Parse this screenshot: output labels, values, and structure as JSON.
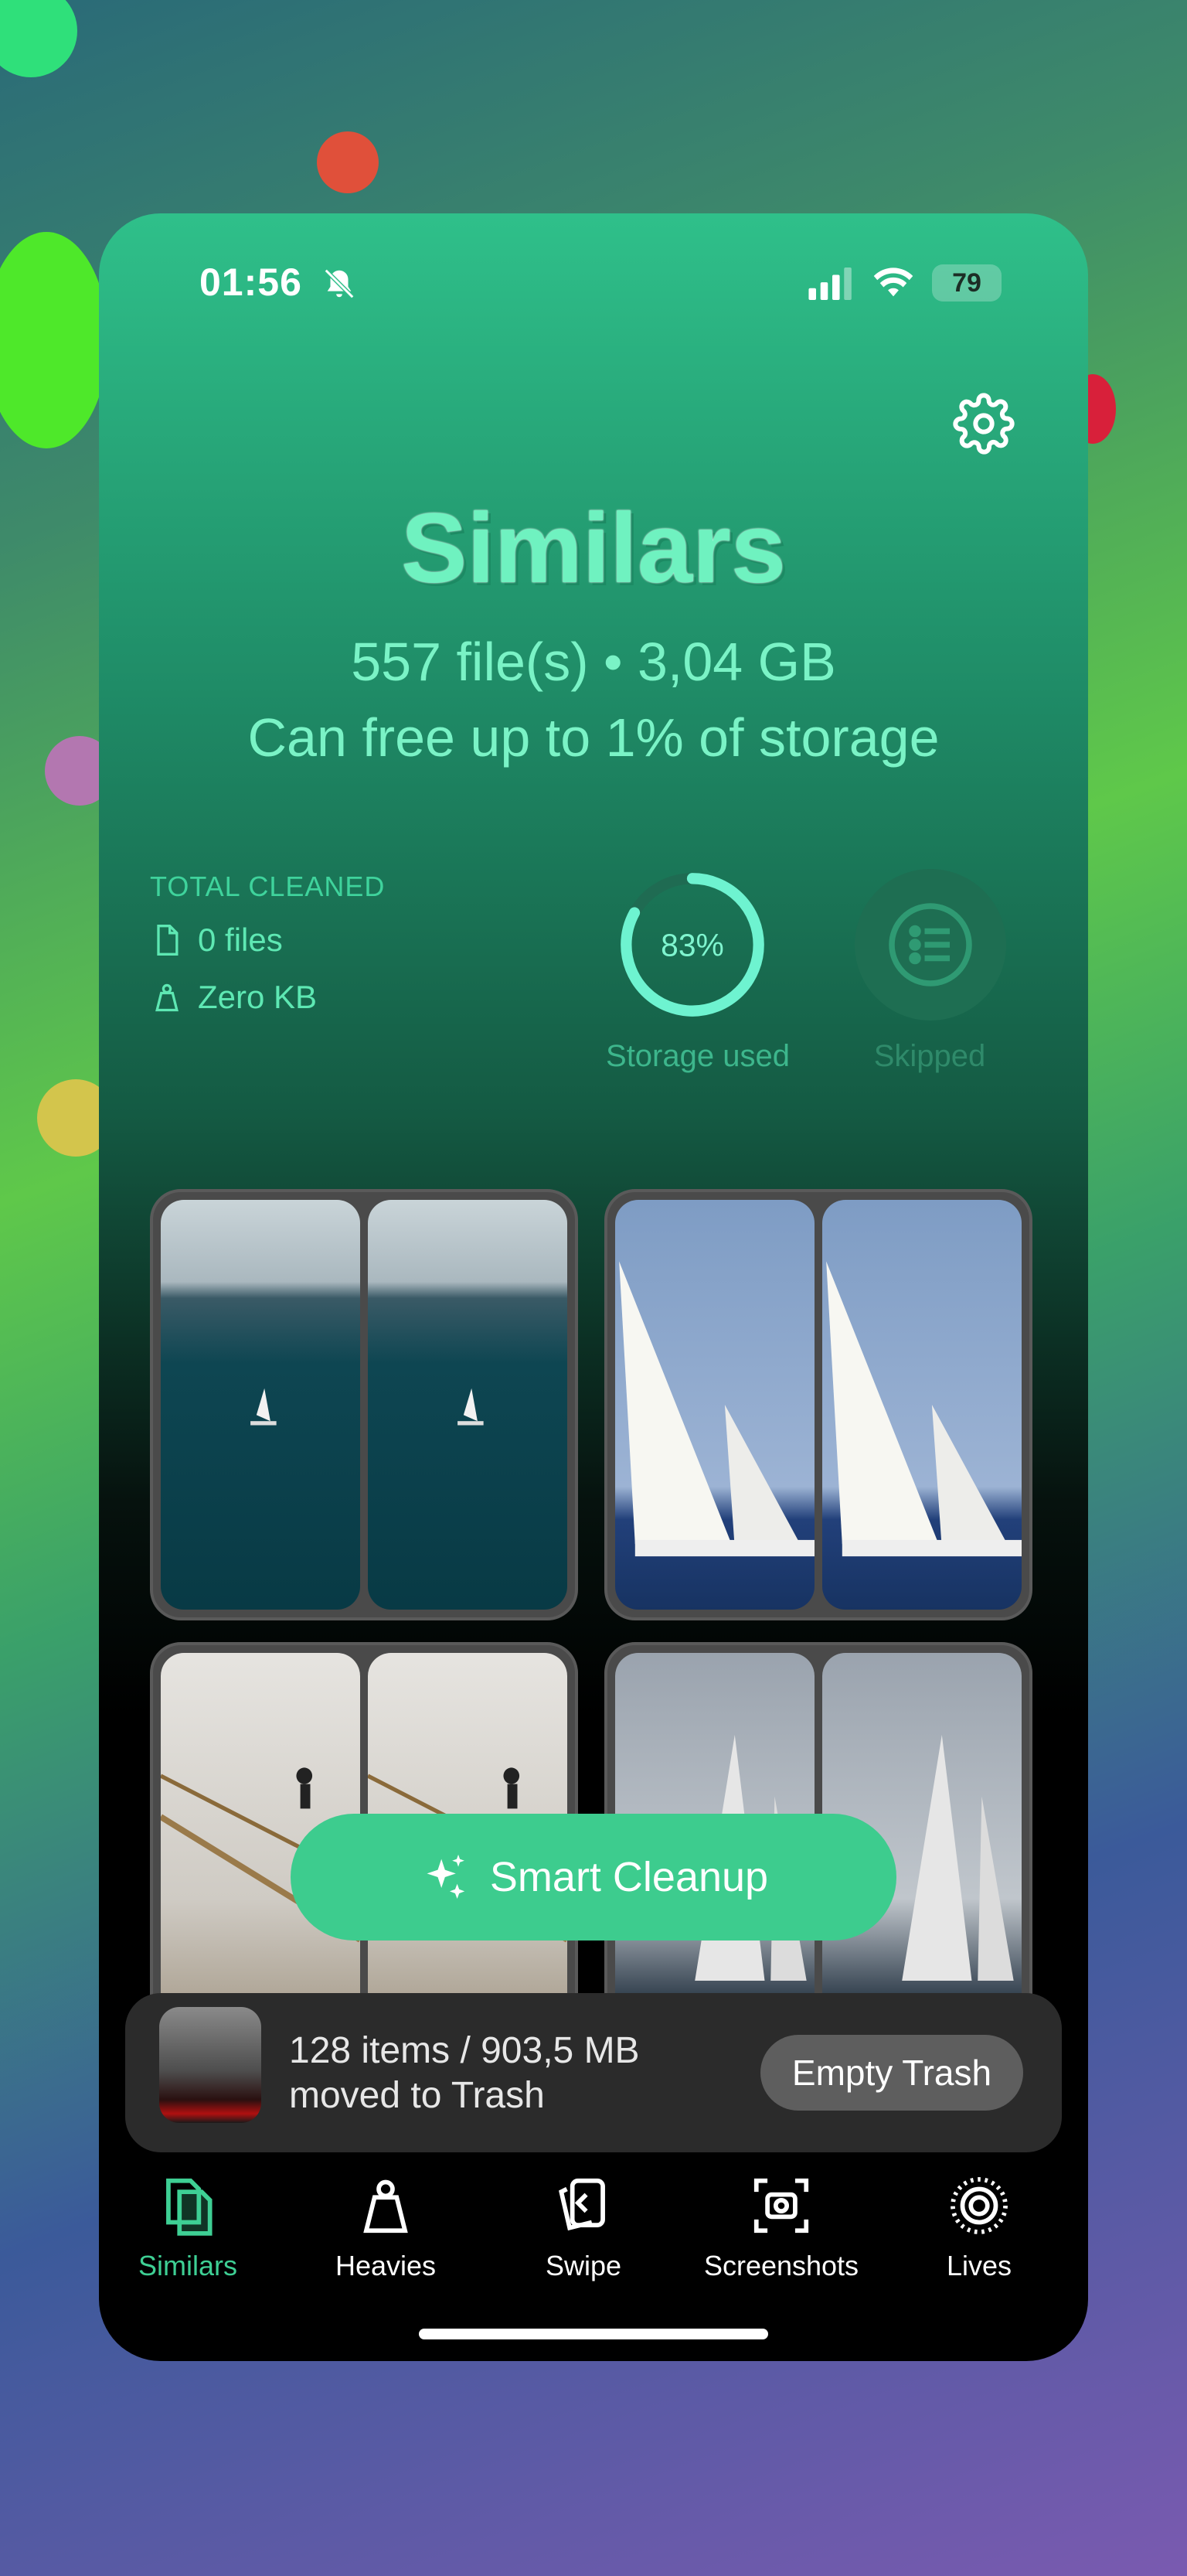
{
  "status": {
    "time": "01:56",
    "battery": "79"
  },
  "header": {
    "title": "Similars",
    "summary": "557 file(s) • 3,04 GB",
    "free_note": "Can free up to 1% of storage"
  },
  "stats": {
    "total_cleaned_label": "TOTAL CLEANED",
    "files": "0 files",
    "size": "Zero KB",
    "storage_percent_text": "83%",
    "storage_used_fraction": 0.83,
    "storage_label": "Storage used",
    "skipped_label": "Skipped"
  },
  "actions": {
    "smart_cleanup": "Smart Cleanup"
  },
  "trash": {
    "line1": "128 items / 903,5 MB",
    "line2": "moved to Trash",
    "empty_button": "Empty Trash"
  },
  "tabs": [
    {
      "label": "Similars",
      "icon": "similars-icon",
      "active": true
    },
    {
      "label": "Heavies",
      "icon": "weight-icon",
      "active": false
    },
    {
      "label": "Swipe",
      "icon": "swipe-cards-icon",
      "active": false
    },
    {
      "label": "Screenshots",
      "icon": "screenshot-icon",
      "active": false
    },
    {
      "label": "Lives",
      "icon": "live-photo-icon",
      "active": false
    }
  ],
  "colors": {
    "accent": "#3dcc8e",
    "title": "#6ff2c0"
  }
}
